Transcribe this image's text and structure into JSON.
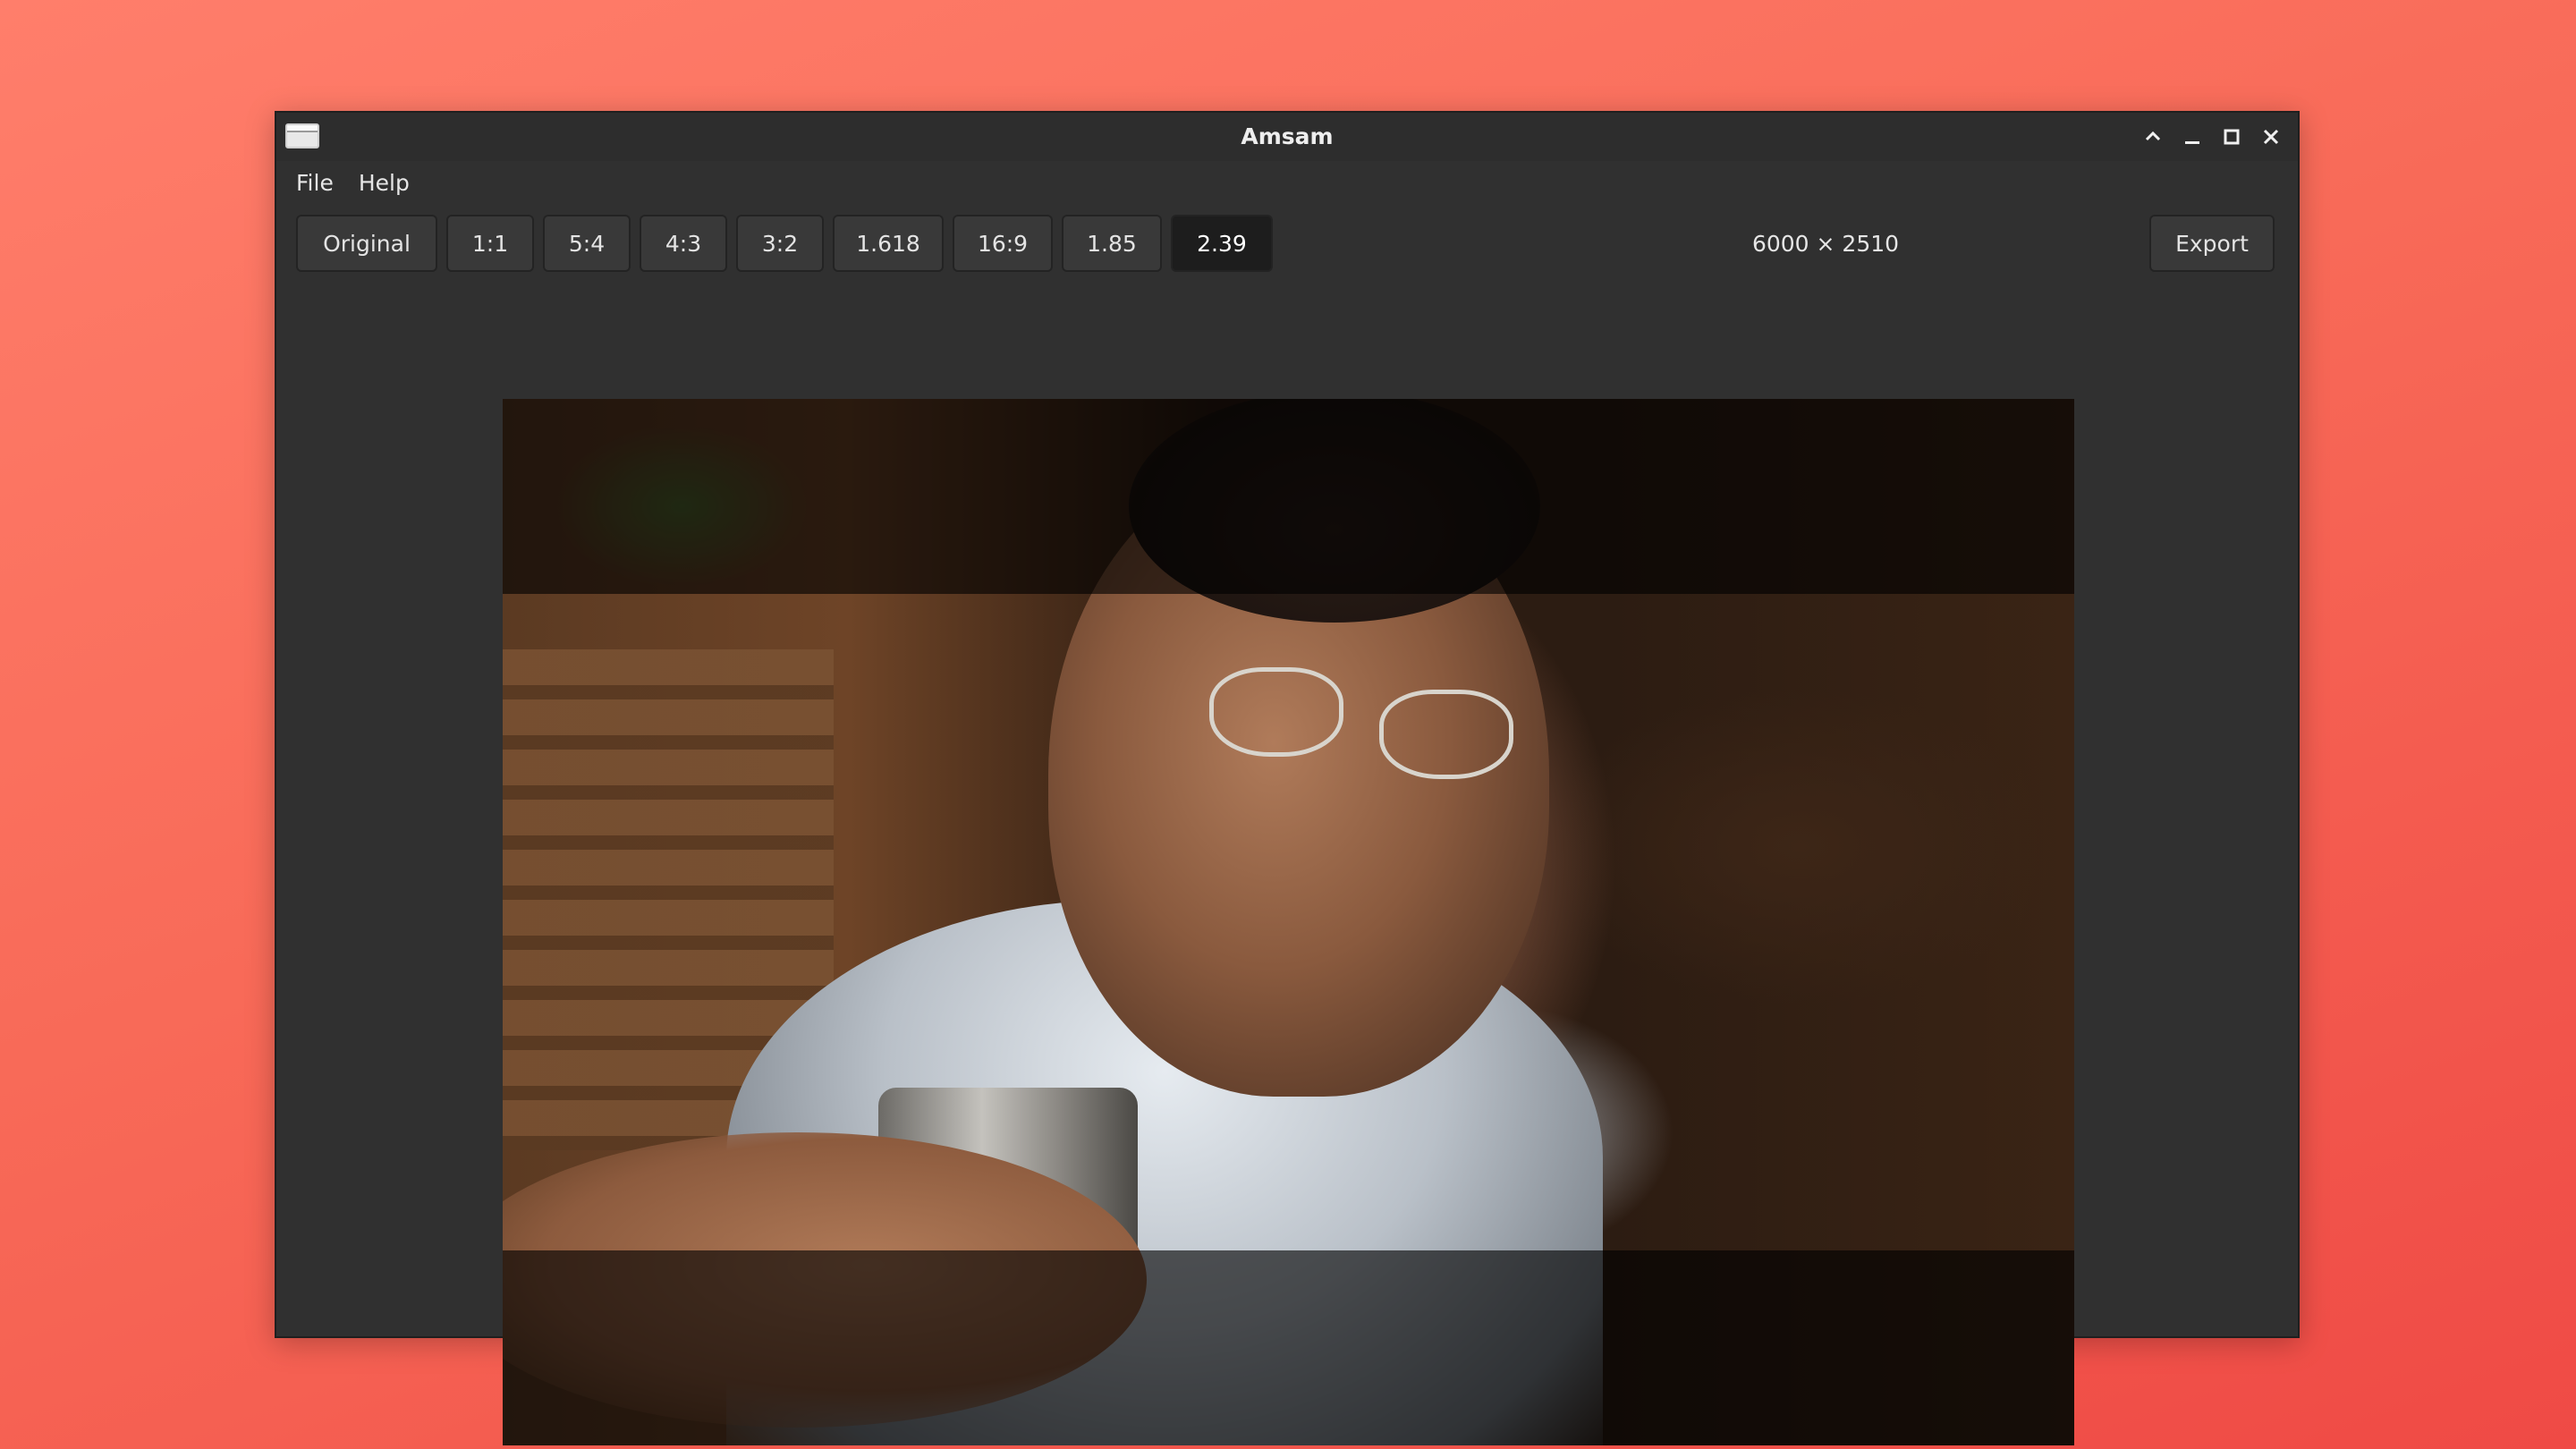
{
  "window": {
    "title": "Amsam"
  },
  "menu": {
    "items": [
      "File",
      "Help"
    ]
  },
  "toolbar": {
    "ratios": [
      "Original",
      "1:1",
      "5:4",
      "4:3",
      "3:2",
      "1.618",
      "16:9",
      "1.85",
      "2.39"
    ],
    "active_ratio": "2.39",
    "dimensions": "6000 × 2510",
    "export_label": "Export"
  },
  "icons": {
    "app": "window-app-icon",
    "controls": [
      "chevron-up-icon",
      "minimize-icon",
      "maximize-icon",
      "close-icon"
    ]
  }
}
